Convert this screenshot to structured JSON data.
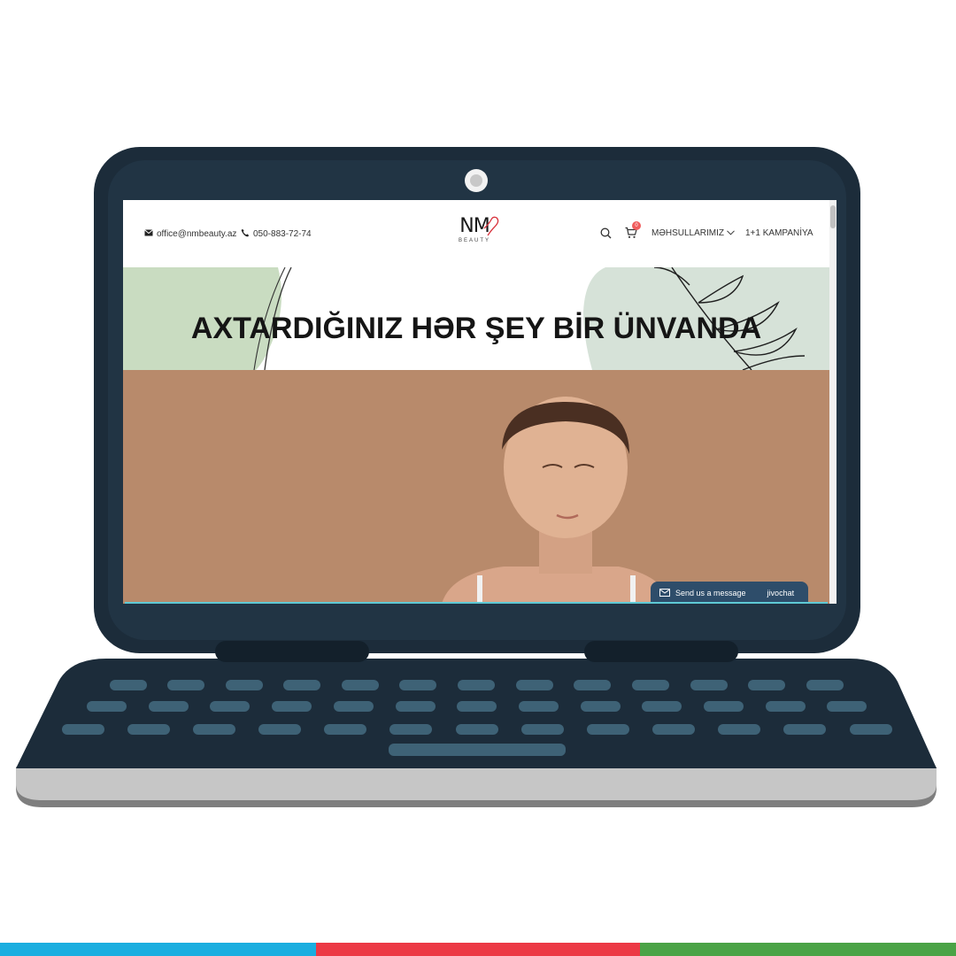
{
  "header": {
    "email": "office@nmbeauty.az",
    "phone": "050-883-72-74",
    "logo_text": "NM",
    "logo_subtext": "BEAUTY",
    "cart_count": "0",
    "nav": [
      {
        "label": "MƏHSULLARIMIZ"
      },
      {
        "label": "1+1 KAMPANİYA"
      }
    ]
  },
  "hero": {
    "title": "AXTARDIĞINIZ HƏR ŞEY BİR ÜNVANDA"
  },
  "chat_widget": {
    "label": "Send us a message",
    "brand": "jivochat"
  },
  "colors": {
    "laptop": "#1c2c3a",
    "hero_green": "#c9dcc1",
    "photo_bg": "#b88a6b",
    "stripe_blue": "#1aaee0",
    "stripe_red": "#ec3945",
    "stripe_green": "#4aa346"
  },
  "icons": [
    "envelope-icon",
    "phone-icon",
    "search-icon",
    "cart-icon",
    "chevron-down-icon",
    "chat-icon",
    "leaf-branch-icon"
  ]
}
